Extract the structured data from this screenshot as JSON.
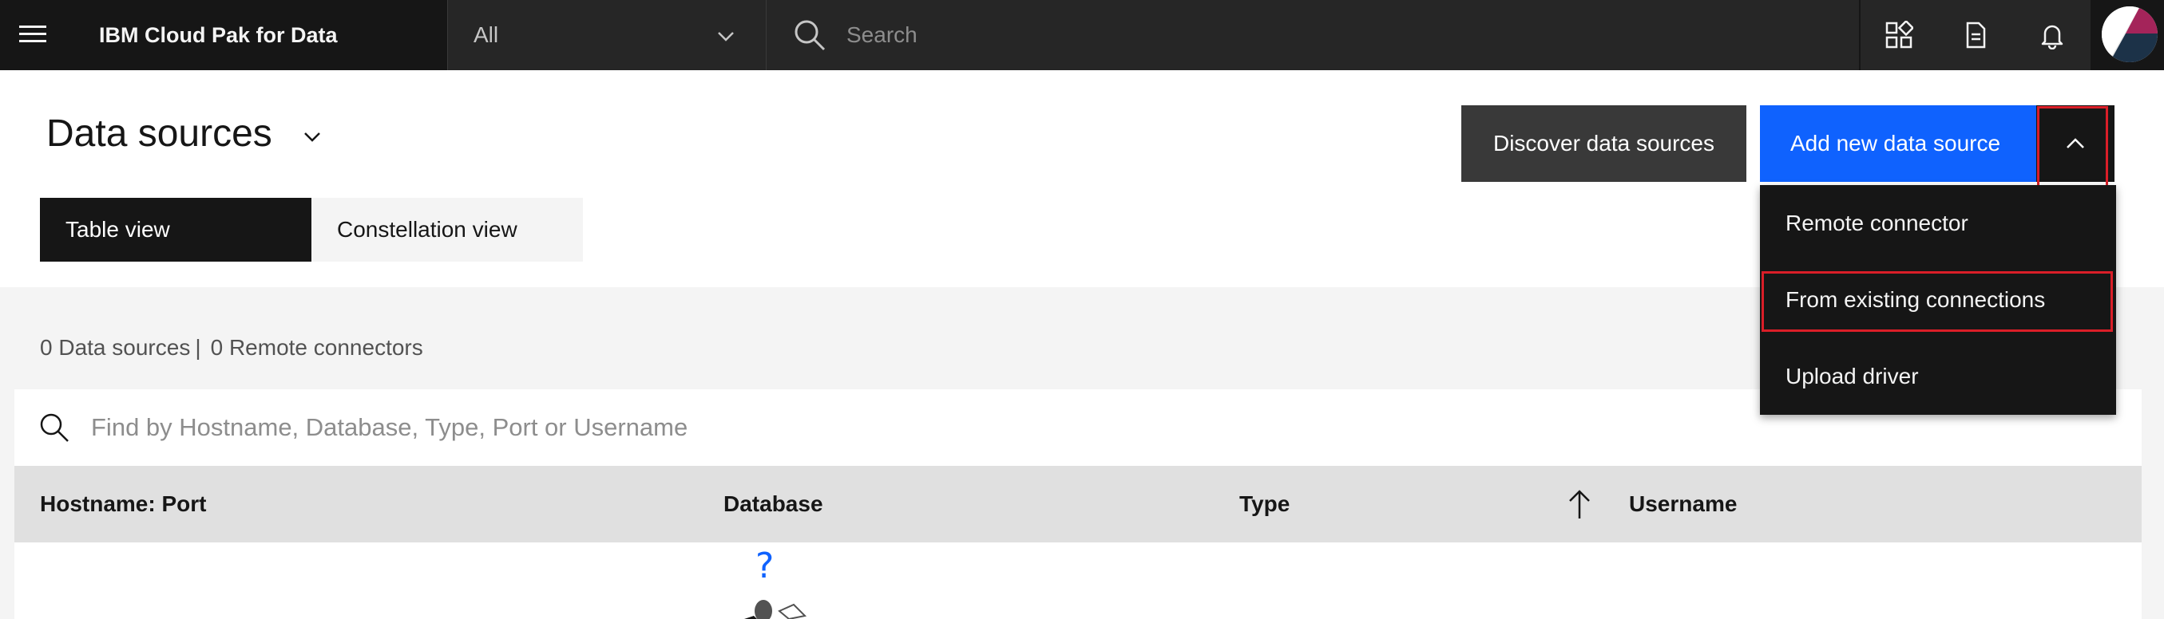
{
  "header": {
    "brand": "IBM Cloud Pak for Data",
    "scope_value": "All",
    "search_placeholder": "Search",
    "icons": [
      "app-switcher-icon",
      "document-icon",
      "notification-icon",
      "user-avatar"
    ]
  },
  "page": {
    "title": "Data sources",
    "views": [
      {
        "label": "Table view",
        "selected": true
      },
      {
        "label": "Constellation view",
        "selected": false
      }
    ],
    "actions": {
      "discover_label": "Discover data sources",
      "add_label": "Add new data source"
    }
  },
  "dropdown_menu": {
    "items": [
      "Remote connector",
      "From existing connections",
      "Upload driver"
    ],
    "highlighted_item": "From existing connections"
  },
  "summary": {
    "data_sources": "0 Data sources",
    "separator": "|",
    "remote_connectors": "0 Remote connectors"
  },
  "table": {
    "filter_placeholder": "Find by Hostname, Database, Type, Port or Username",
    "columns": [
      "Hostname: Port",
      "Database",
      "Type",
      "Username"
    ],
    "sort_column": "Type",
    "rows": [],
    "empty_illustration_glyph": "?"
  },
  "colors": {
    "header_bg": "#161616",
    "primary": "#0f62fe",
    "secondary": "#393939",
    "highlight_border": "#da1e28",
    "content_bg": "#f4f4f4",
    "table_header_bg": "#e0e0e0"
  }
}
